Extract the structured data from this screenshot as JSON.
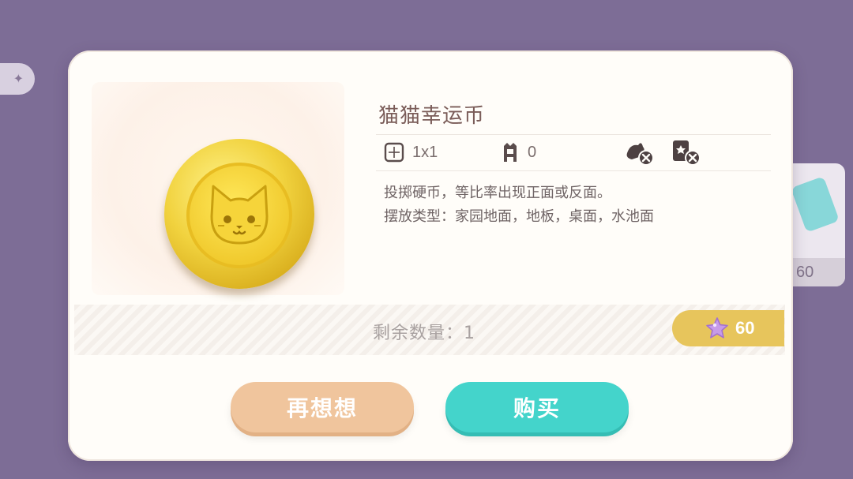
{
  "background": {
    "right_card_price": "60"
  },
  "item": {
    "name": "猫猫幸运币",
    "size_value": "1x1",
    "comfort_value": "0",
    "description_line1": "投掷硬币，等比率出现正面或反面。",
    "description_line2": "摆放类型：家园地面，地板，桌面，水池面",
    "remaining_label": "剩余数量：1",
    "price": "60"
  },
  "buttons": {
    "cancel_label": "再想想",
    "buy_label": "购买"
  },
  "icons": {
    "size": "grid-size-icon",
    "comfort": "furniture-comfort-icon",
    "no_interact": "no-interaction-icon",
    "no_edit": "no-edit-icon",
    "currency": "purple-star-icon",
    "coin": "cat-coin-icon"
  },
  "colors": {
    "accent_teal": "#44d4cb",
    "accent_peach": "#f0c59d",
    "price_gold": "#e7c55c",
    "background": "#7d6d96"
  }
}
